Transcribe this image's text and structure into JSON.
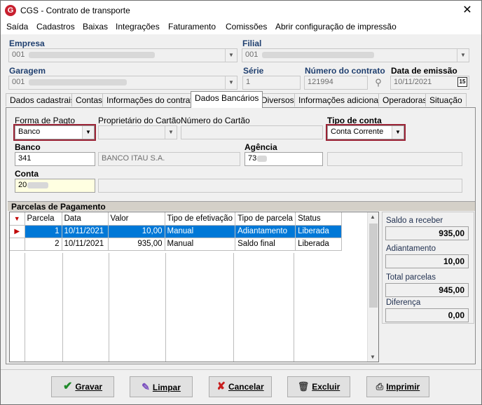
{
  "window": {
    "title": "CGS - Contrato de transporte",
    "logo": "G"
  },
  "menu": [
    "Saída",
    "Cadastros",
    "Baixas",
    "Integrações",
    "Faturamento",
    "Comissões",
    "Abrir configuração de impressão"
  ],
  "header": {
    "empresa_label": "Empresa",
    "empresa_value": "001",
    "filial_label": "Filial",
    "filial_value": "001",
    "garagem_label": "Garagem",
    "garagem_value": "001",
    "serie_label": "Série",
    "serie_value": "1",
    "numero_label": "Número do contrato",
    "numero_value": "121994",
    "data_label": "Data de emissão",
    "data_value": "10/11/2021",
    "calendar_icon_text": "15"
  },
  "tabs": [
    "Dados cadastrais",
    "Contas",
    "Informações do contrato",
    "Dados Bancários",
    "Diversos",
    "Informações adicionais",
    "Operadoras",
    "Situação"
  ],
  "active_tab": "Dados Bancários",
  "bank": {
    "forma_label": "Forma de Pagto",
    "forma_value": "Banco",
    "proprietario_label": "Proprietário do Cartão",
    "proprietario_value": "",
    "numero_cartao_label": "Número do Cartão",
    "numero_cartao_value": "",
    "tipo_conta_label": "Tipo de conta",
    "tipo_conta_value": "Conta Corrente",
    "banco_label": "Banco",
    "banco_code": "341",
    "banco_name": "BANCO ITAU S.A.",
    "agencia_label": "Agência",
    "agencia_value": "73",
    "conta_label": "Conta",
    "conta_value": "20"
  },
  "parcelas": {
    "title": "Parcelas de Pagamento",
    "columns": [
      "Parcela",
      "Data",
      "Valor",
      "Tipo de efetivação",
      "Tipo de parcela",
      "Status"
    ],
    "rows": [
      {
        "parcela": "1",
        "data": "10/11/2021",
        "valor": "10,00",
        "efetivacao": "Manual",
        "tipo": "Adiantamento",
        "status": "Liberada"
      },
      {
        "parcela": "2",
        "data": "10/11/2021",
        "valor": "935,00",
        "efetivacao": "Manual",
        "tipo": "Saldo final",
        "status": "Liberada"
      }
    ]
  },
  "summary": {
    "saldo_label": "Saldo a receber",
    "saldo_value": "935,00",
    "adiantamento_label": "Adiantamento",
    "adiantamento_value": "10,00",
    "total_label": "Total parcelas",
    "total_value": "945,00",
    "diferenca_label": "Diferença",
    "diferenca_value": "0,00"
  },
  "buttons": {
    "gravar": "Gravar",
    "limpar": "Limpar",
    "cancelar": "Cancelar",
    "excluir": "Excluir",
    "imprimir": "Imprimir"
  },
  "colors": {
    "accent_red": "#9b2335",
    "selection": "#0078d7",
    "label_blue": "#1f3f6f",
    "logo_red": "#c8202f"
  }
}
